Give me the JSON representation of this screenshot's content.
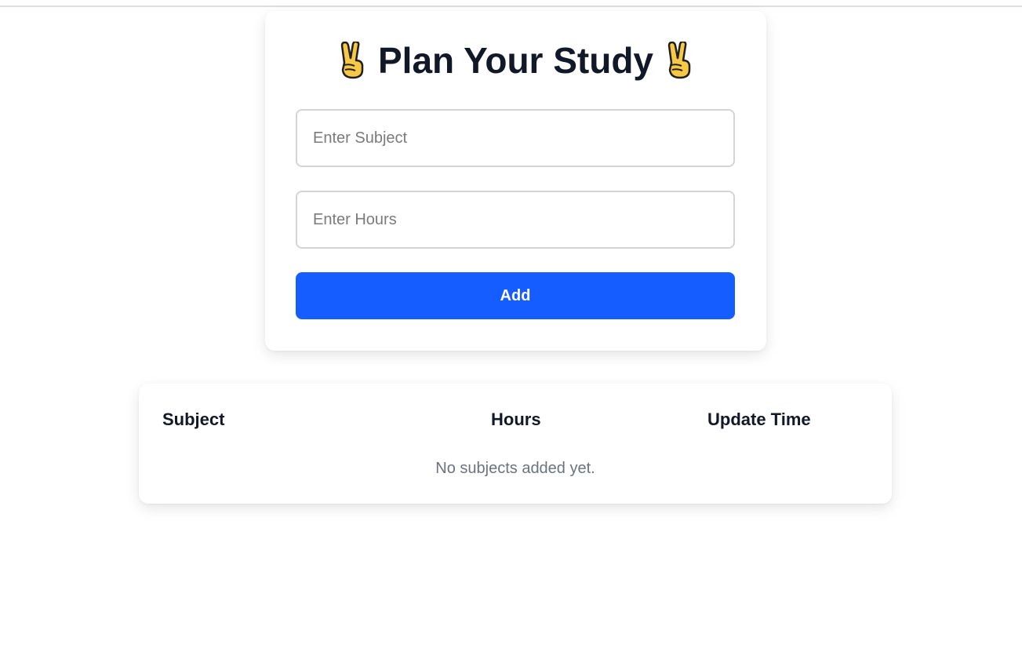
{
  "form": {
    "title": "Plan Your Study",
    "title_icon": "victory-hand-icon",
    "subject_placeholder": "Enter Subject",
    "hours_placeholder": "Enter Hours",
    "add_label": "Add"
  },
  "table": {
    "columns": [
      "Subject",
      "Hours",
      "Update Time"
    ],
    "empty_message": "No subjects added yet."
  },
  "colors": {
    "accent": "#165dff",
    "heading": "#111827",
    "muted": "#6b7280"
  }
}
